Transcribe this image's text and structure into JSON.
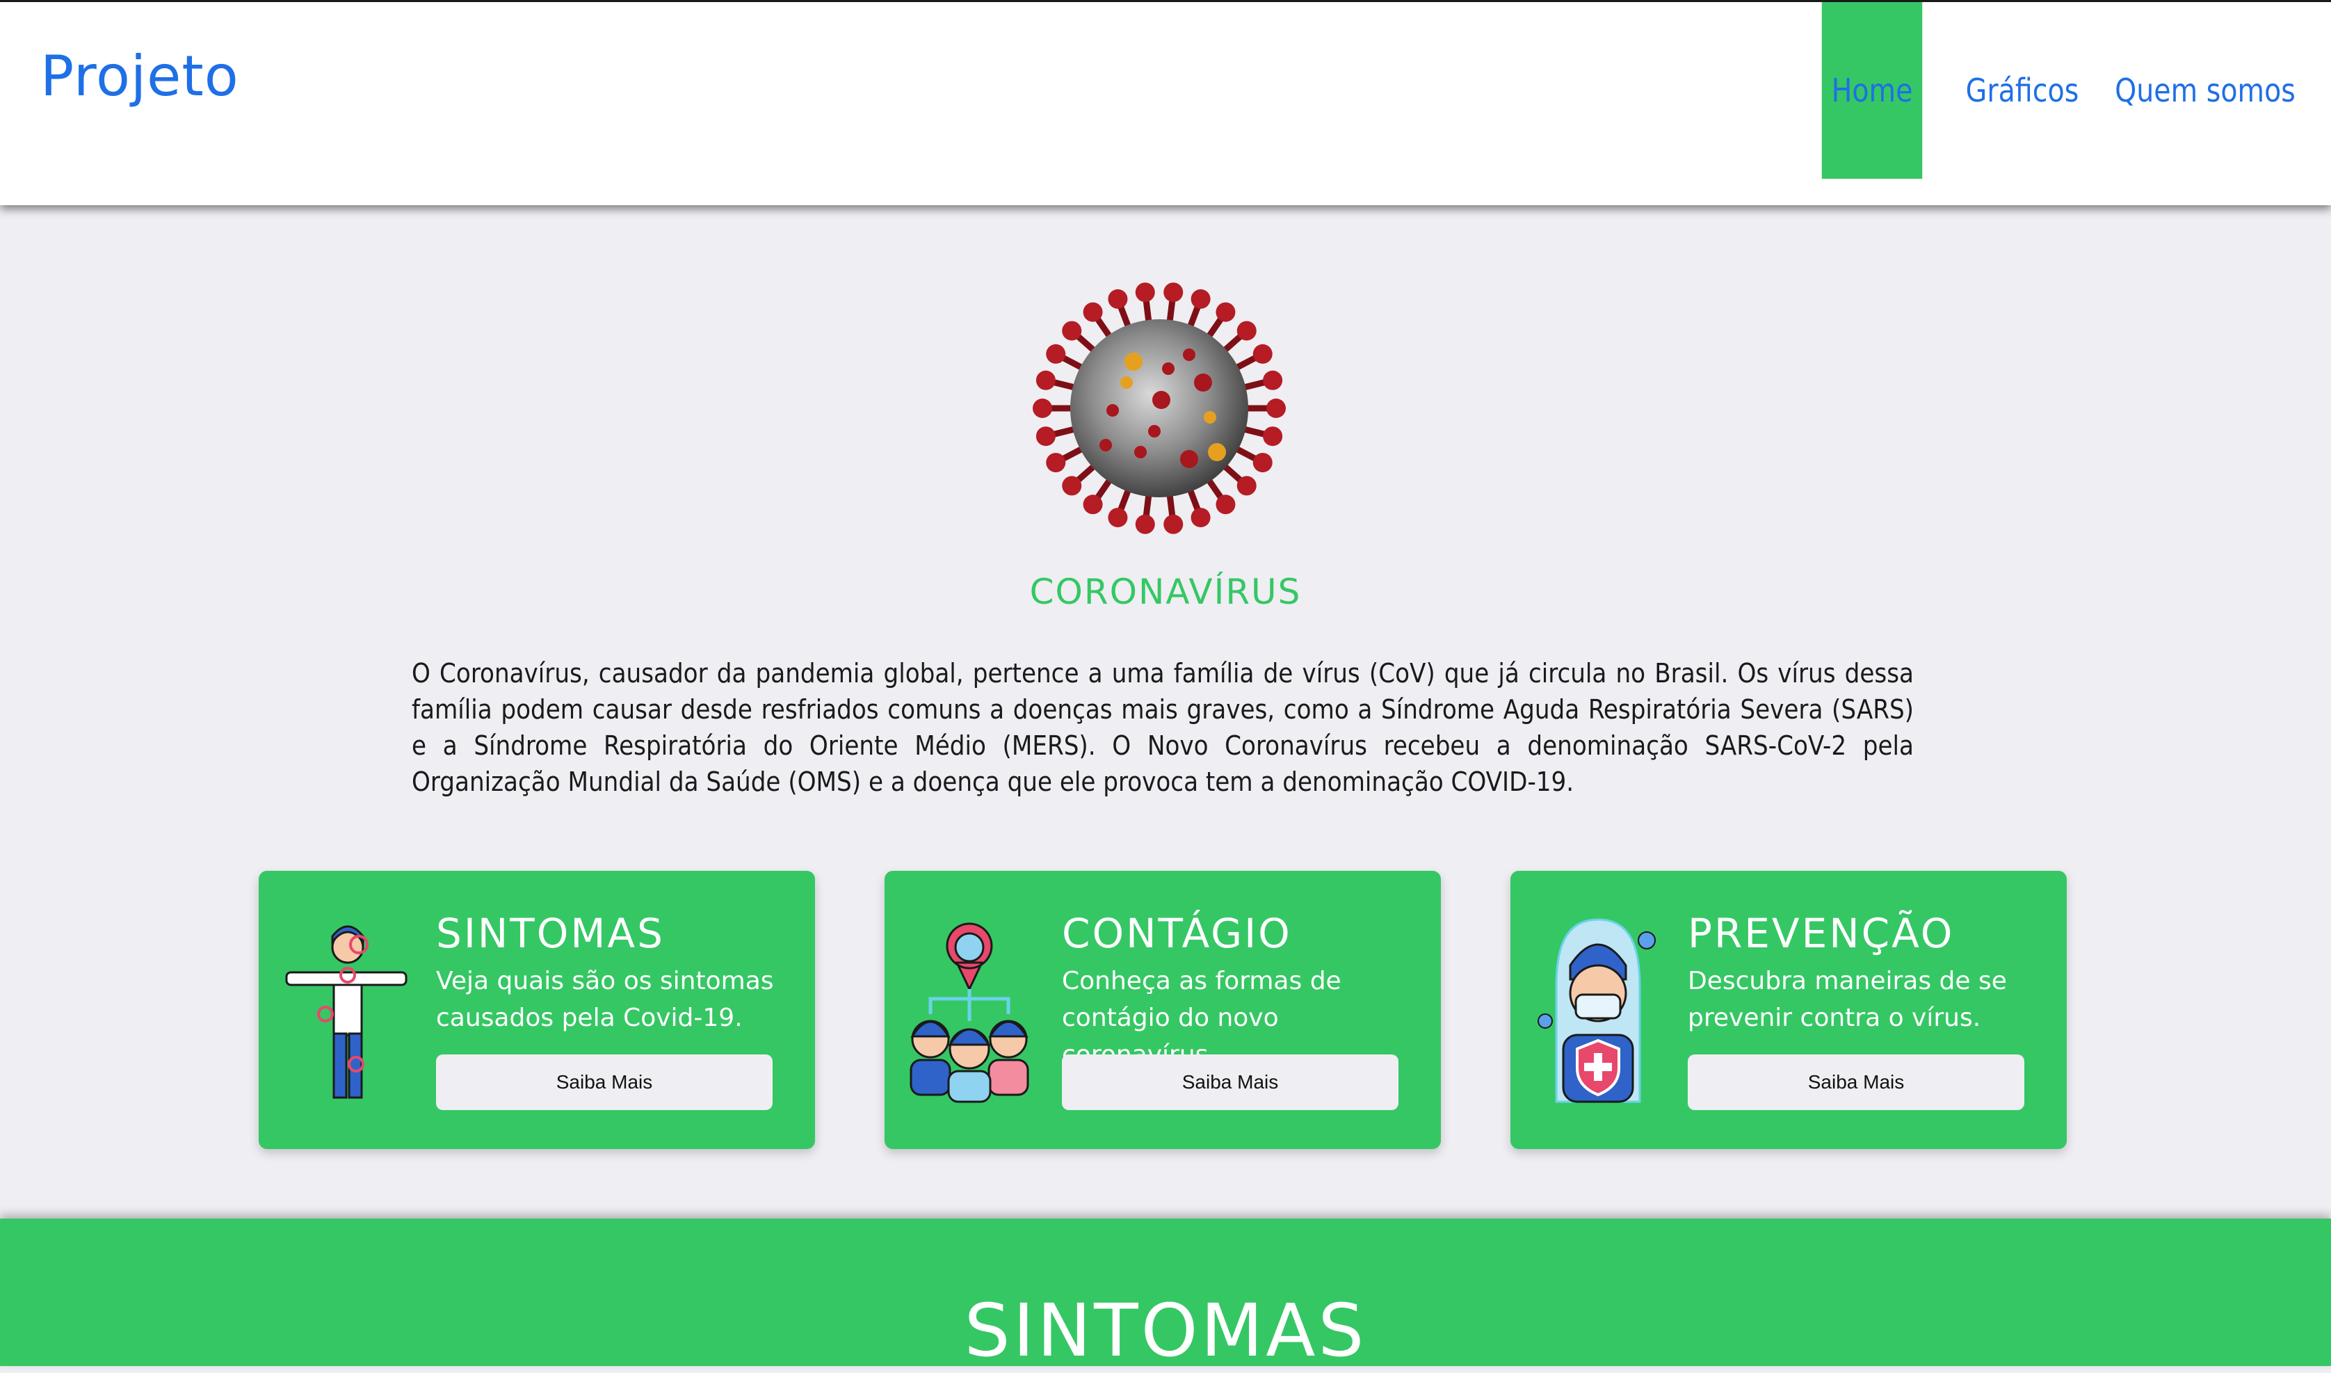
{
  "header": {
    "brand": "Projeto",
    "nav": [
      {
        "label": "Home",
        "active": true
      },
      {
        "label": "Gráficos",
        "active": false
      },
      {
        "label": "Quem somos",
        "active": false
      }
    ]
  },
  "hero": {
    "title": "CORONAVÍRUS",
    "text": "O Coronavírus, causador da pandemia global, pertence a uma família de vírus (CoV) que já circula no Brasil. Os vírus dessa família podem causar desde resfriados comuns a doenças mais graves, como a Síndrome Aguda Respiratória Severa (SARS) e a Síndrome Respiratória do Oriente Médio (MERS). O Novo Coronavírus recebeu a denominação SARS-CoV-2 pela Organização Mundial da Saúde (OMS) e a doença que ele provoca tem a denominação COVID-19."
  },
  "cards": [
    {
      "title": "SINTOMAS",
      "text": "Veja quais são os sintomas causados pela Covid-19.",
      "button": "Saiba Mais",
      "icon": "person-symptoms-icon"
    },
    {
      "title": "CONTÁGIO",
      "text": "Conheça as formas de contágio do novo coronavírus.",
      "button": "Saiba Mais",
      "icon": "people-contagion-icon"
    },
    {
      "title": "PREVENÇÃO",
      "text": "Descubra maneiras de se prevenir contra o vírus.",
      "button": "Saiba Mais",
      "icon": "doctor-mask-shield-icon"
    }
  ],
  "band": {
    "title": "SINTOMAS"
  },
  "colors": {
    "accent": "#35c764",
    "link": "#1f6fe6",
    "background": "#efeef3"
  }
}
